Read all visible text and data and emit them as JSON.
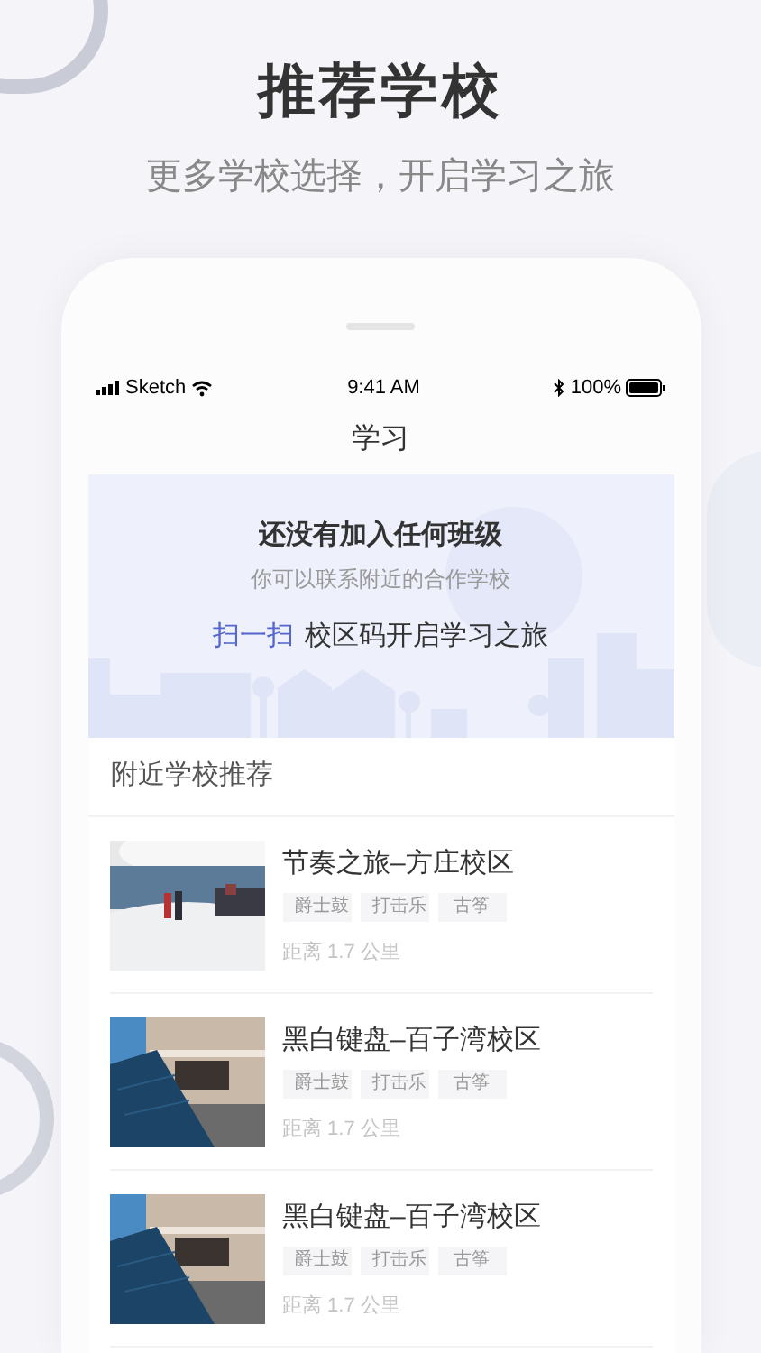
{
  "hero": {
    "title": "推荐学校",
    "subtitle": "更多学校选择，开启学习之旅"
  },
  "status_bar": {
    "carrier": "Sketch",
    "time": "9:41 AM",
    "battery": "100%"
  },
  "nav": {
    "title": "学习"
  },
  "banner": {
    "title": "还没有加入任何班级",
    "subtitle": "你可以联系附近的合作学校",
    "scan_link": "扫一扫",
    "scan_text": "校区码开启学习之旅"
  },
  "section": {
    "title": "附近学校推荐"
  },
  "schools": [
    {
      "name": "节奏之旅–方庄校区",
      "tags": [
        "爵士鼓",
        "打击乐",
        "古筝"
      ],
      "distance": "距离 1.7 公里",
      "kind": "picture"
    },
    {
      "name": "黑白键盘–百子湾校区",
      "tags": [
        "爵士鼓",
        "打击乐",
        "古筝"
      ],
      "distance": "距离 1.7 公里",
      "kind": "picture"
    },
    {
      "name": "黑白键盘–百子湾校区",
      "tags": [
        "爵士鼓",
        "打击乐",
        "古筝"
      ],
      "distance": "距离 1.7 公里",
      "kind": "picture"
    }
  ]
}
